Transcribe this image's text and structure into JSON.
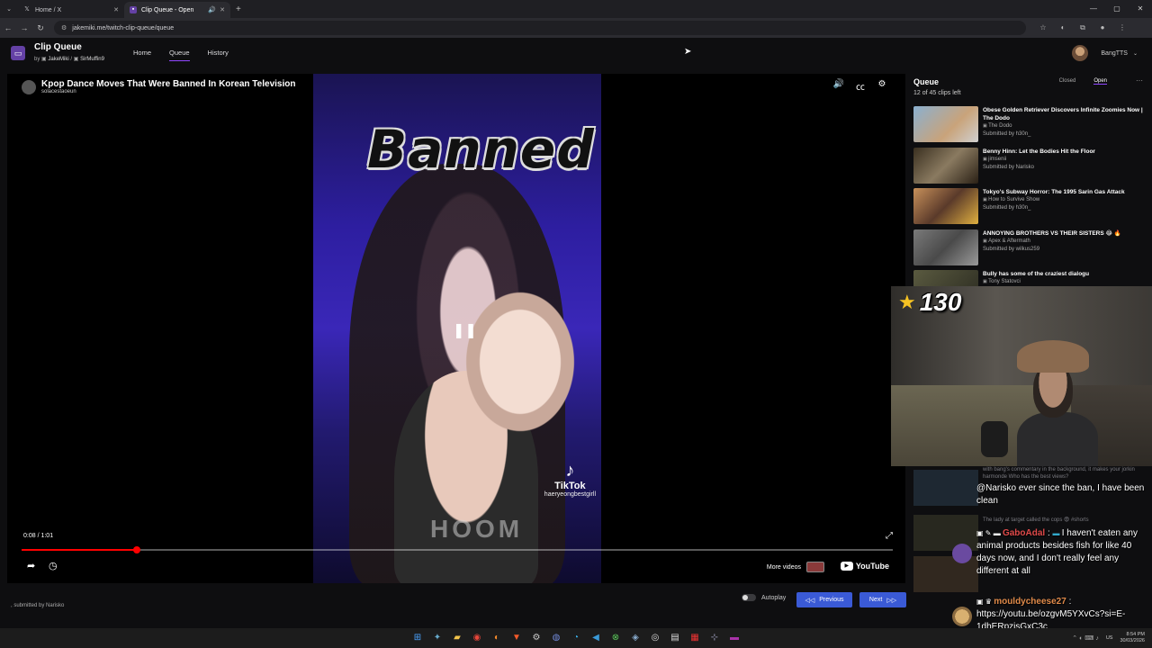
{
  "browser": {
    "tabs": [
      {
        "label": "Home / X",
        "icon": "x-logo-icon",
        "active": false
      },
      {
        "label": "Clip Queue - Open",
        "icon": "clip-queue-icon",
        "active": true
      }
    ],
    "url": "jakemiki.me/twitch-clip-queue/queue"
  },
  "app": {
    "title": "Clip Queue",
    "by": "by",
    "author1": "JakeMiki",
    "sep": "/",
    "author2": "SirMuffin9",
    "nav": [
      "Home",
      "Queue",
      "History"
    ],
    "active_nav": "Queue",
    "user": "BangTTS"
  },
  "player": {
    "title": "Kpop Dance Moves That Were Banned In Korean Television",
    "channel": "solacestaoeun",
    "overlay_text": "Banned",
    "current_time": "0:08",
    "time_sep": " / ",
    "duration": "1:01",
    "progress": 0.132,
    "tiktok_word": "TikTok",
    "tiktok_handle": "haeryeongbestgirll",
    "more_videos": "More videos",
    "youtube": "YouTube",
    "neon_text": "HOOM"
  },
  "footer": {
    "submitted_prefix": ", submitted by",
    "submitted_by": "Narisko",
    "autoplay": "Autoplay",
    "previous": "Previous",
    "next": "Next"
  },
  "queue": {
    "title": "Queue",
    "count": "12 of 45 clips left",
    "tab_closed": "Closed",
    "tab_open": "Open",
    "items": [
      {
        "title": "Obese Golden Retriever Discovers Infinite Zoomies Now | The Dodo",
        "channel": "The Dodo",
        "submitted": "Submitted by h30n_",
        "color": "#6d8ab0"
      },
      {
        "title": "Benny Hinn: Let the Bodies Hit the Floor",
        "channel": "jimsenii",
        "submitted": "Submitted by Narisko",
        "color": "#5a4a3a"
      },
      {
        "title": "Tokyo's Subway Horror: The 1995 Sarin Gas Attack",
        "channel": "How to Survive Show",
        "submitted": "Submitted by h30n_",
        "color": "#8a5a3a"
      },
      {
        "title": "ANNOYING BROTHERS VS THEIR SISTERS 😂 🔥",
        "channel": "Apex & Aftermath",
        "submitted": "Submitted by wilkus259",
        "color": "#6a6a6a"
      },
      {
        "title": "Bully has some of the craziest dialogu",
        "channel": "Tony Statovci",
        "submitted": "",
        "color": "#4a4a3a"
      }
    ]
  },
  "stream_overlay": {
    "counter": "130"
  },
  "chat": {
    "faint": [
      "with bang's commentary in the background, it makes your jorkin harmonde  Who has the best views?",
      "The lady at target called the cops 😨 #shorts"
    ],
    "messages": [
      {
        "name": "",
        "text": "@Narisko ever since the ban, I have been clean",
        "color": "#ffffff"
      },
      {
        "name": "GaboAdal",
        "sep": " : ",
        "text": "I haven't eaten any animal products besides fish for like 40 days now, and I don't really feel any different at all",
        "color": "#e04a4a"
      },
      {
        "name": "mouldycheese27",
        "sep": " : ",
        "text": "https://youtu.be/ozgvM5YXvCs?si=E-1dhERpzjsGxC3c",
        "color": "#e08a4a"
      }
    ]
  },
  "taskbar": {
    "tray_left": "US",
    "time": "8:54 PM",
    "date": "30/03/2026"
  },
  "colors": {
    "accent": "#9147ff",
    "button": "#3a5ad6",
    "progress": "#ff0000",
    "background": "#0e0e10"
  }
}
